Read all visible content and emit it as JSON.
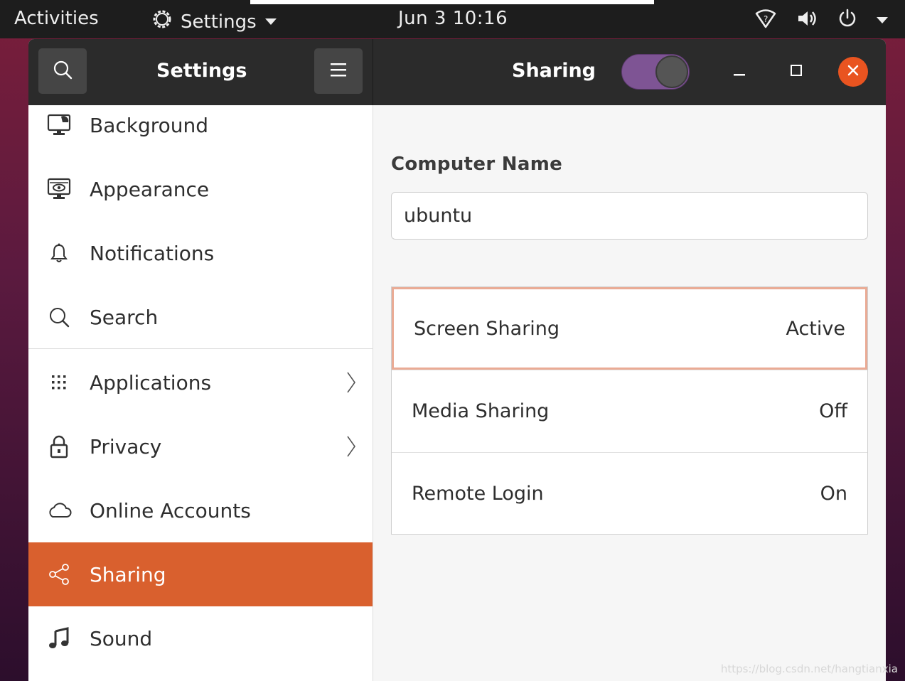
{
  "topbar": {
    "activities": "Activities",
    "app_menu": "Settings",
    "clock": "Jun 3  10:16"
  },
  "headerbar": {
    "sidebar_title": "Settings",
    "panel_title": "Sharing",
    "sharing_toggle_on": true
  },
  "sidebar": {
    "items": [
      {
        "label": "Background",
        "icon": "display-icon"
      },
      {
        "label": "Appearance",
        "icon": "appearance-icon"
      },
      {
        "label": "Notifications",
        "icon": "bell-icon"
      },
      {
        "label": "Search",
        "icon": "search-icon"
      },
      {
        "label": "Applications",
        "icon": "grid-icon",
        "has_submenu": true
      },
      {
        "label": "Privacy",
        "icon": "lock-icon",
        "has_submenu": true
      },
      {
        "label": "Online Accounts",
        "icon": "cloud-icon"
      },
      {
        "label": "Sharing",
        "icon": "share-icon",
        "active": true
      },
      {
        "label": "Sound",
        "icon": "music-note-icon"
      }
    ]
  },
  "content": {
    "computer_name_title": "Computer Name",
    "computer_name_value": "ubuntu",
    "rows": [
      {
        "label": "Screen Sharing",
        "status": "Active"
      },
      {
        "label": "Media Sharing",
        "status": "Off"
      },
      {
        "label": "Remote Login",
        "status": "On"
      }
    ]
  },
  "watermark": "https://blog.csdn.net/hangtianxia",
  "colors": {
    "accent": "#d9602e",
    "close": "#e95420",
    "toggle": "#7e5494",
    "topbar": "#1d1d1d",
    "headerbar": "#2b2b2b"
  }
}
